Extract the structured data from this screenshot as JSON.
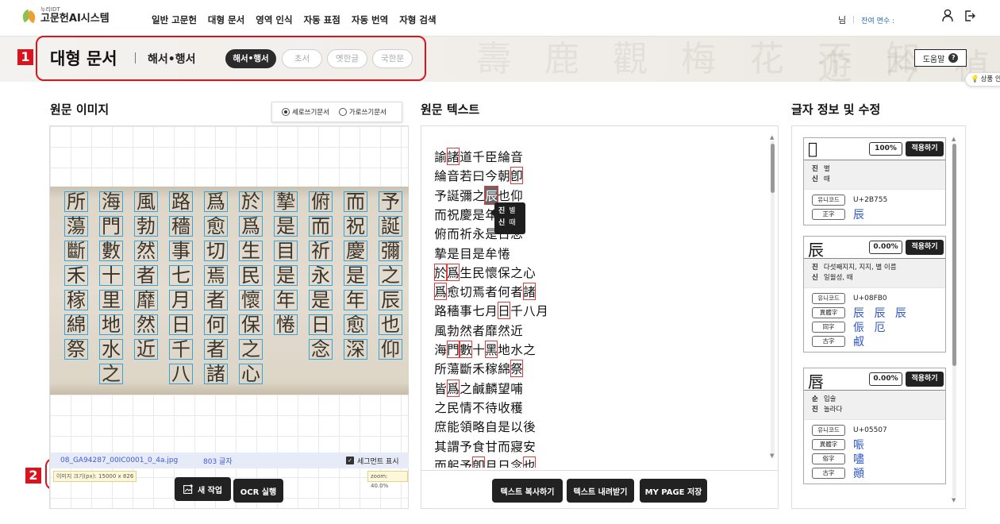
{
  "header": {
    "logo_sub": "누리IDT",
    "logo_main": "고문헌AI시스템",
    "menu": [
      "일반 고문헌",
      "대형 문서",
      "영역 인식",
      "자동 표점",
      "자동 번역",
      "자형 검색"
    ],
    "user_suffix": "님",
    "quota_label": "잔여 면수 :"
  },
  "banner": {
    "title": "대형 문서",
    "subtitle": "해서•행서",
    "tabs": [
      {
        "label": "해서•행서",
        "active": true
      },
      {
        "label": "초서",
        "active": false
      },
      {
        "label": "옛한글",
        "active": false
      },
      {
        "label": "국한문",
        "active": false
      }
    ],
    "help_label": "도움말",
    "side_tag": "상품 안내"
  },
  "annotations": {
    "box1": "1",
    "box2": "2"
  },
  "left": {
    "title": "원문 이미지",
    "radio_vertical": "세로쓰기문서",
    "radio_horizontal": "가로쓰기문서",
    "vertical_selected": true,
    "columns": [
      "予誕彌之辰也仰",
      "而祝慶是年愈深",
      "俯而祈永是日念",
      "摯是目是年惓",
      "於爲生民懷保之心",
      "爲愈切焉者何者諸",
      "路穡事七月日千八",
      "風勃然者靡然近",
      "海門數十里地水之",
      "所蕩斷禾稼綿祭"
    ],
    "file_name": "08_GA94287_00IC0001_0_4a.jpg",
    "char_count": "803 글자",
    "segment_toggle": "세그먼트 표시",
    "image_size": "이미지 크기(px): 15000 x 826",
    "zoom": "zoom: 40.0%",
    "new_job": "새 작업",
    "run_ocr": "OCR 실행"
  },
  "middle": {
    "title": "원문 텍스트",
    "lines": [
      "諭諸道千臣綸音",
      "綸音若曰今朝卽",
      "予誕彌之辰也仰",
      "而祝慶是年愈深",
      "俯而祈永是日念",
      "摯是目是牟惓",
      "於爲生民懷保之心",
      "爲愈切焉者何者諸",
      "路穡事七月日千八月",
      "風勃然者靡然近",
      "海門數十黑地水之",
      "所蕩斷禾稼綿祭",
      "皆爲之鹹麟望哺",
      "之民情不待收穫",
      "庶能領略自是以後",
      "其謂予食甘而寢安",
      "而躬予卽月日念也"
    ],
    "tooltip": [
      {
        "k": "진",
        "v": "별"
      },
      {
        "k": "신",
        "v": "때"
      }
    ],
    "copy_btn": "텍스트 복사하기",
    "download_btn": "텍스트 내려받기",
    "save_btn": "MY PAGE 저장"
  },
  "right": {
    "title": "글자 정보 및 수정",
    "apply_label": "적용하기",
    "unicode_label": "유니코드",
    "cards": [
      {
        "char": "𫝕",
        "pct": "100%",
        "readings": [
          {
            "k": "진",
            "v": "별"
          },
          {
            "k": "신",
            "v": "때"
          }
        ],
        "unicode": "U+2B755",
        "variants": [
          {
            "type": "正字",
            "chars": "辰"
          }
        ]
      },
      {
        "char": "辰",
        "pct": "0.00%",
        "readings": [
          {
            "k": "진",
            "v": "다섯째지지, 지지, 별 이름"
          },
          {
            "k": "신",
            "v": "일월성, 때"
          }
        ],
        "unicode": "U+08FB0",
        "variants": [
          {
            "type": "異體字",
            "chars": "辰 辰 辰"
          },
          {
            "type": "同字",
            "chars": "侲 厄"
          },
          {
            "type": "古字",
            "chars": "㕟"
          }
        ]
      },
      {
        "char": "唇",
        "pct": "0.00%",
        "readings": [
          {
            "k": "순",
            "v": "입술"
          },
          {
            "k": "진",
            "v": "놀라다"
          }
        ],
        "unicode": "U+05507",
        "variants": [
          {
            "type": "異體字",
            "chars": "㖘"
          },
          {
            "type": "俗字",
            "chars": "嚍"
          },
          {
            "type": "古字",
            "chars": "顚"
          }
        ]
      }
    ]
  }
}
